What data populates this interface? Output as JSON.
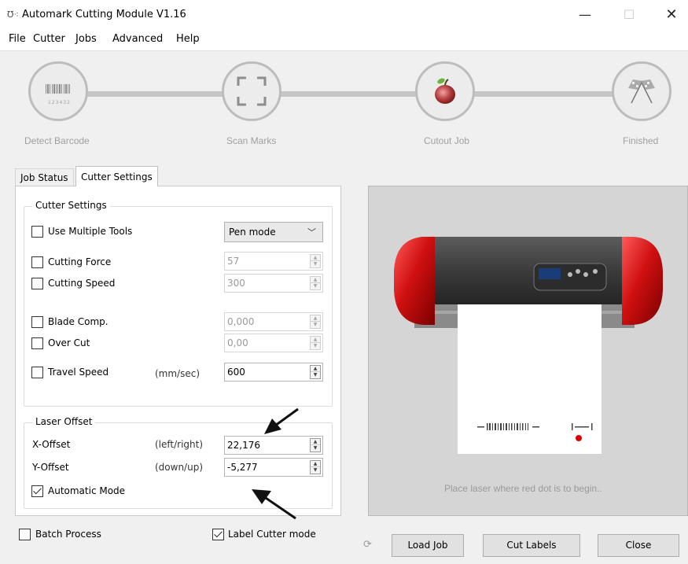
{
  "window": {
    "title": "Automark Cutting Module V1.16",
    "controls": {
      "minimize": "—",
      "maximize": "☐",
      "close": "✕"
    }
  },
  "menu": [
    "File",
    "Cutter",
    "Jobs",
    "Advanced",
    "Help"
  ],
  "steps": [
    {
      "label": "Detect Barcode",
      "icon": "barcode-icon",
      "barcode_digits": "123432"
    },
    {
      "label": "Scan Marks",
      "icon": "scan-frame-icon"
    },
    {
      "label": "Cutout Job",
      "icon": "apple-icon"
    },
    {
      "label": "Finished",
      "icon": "checkered-flags-icon"
    }
  ],
  "tabs": {
    "job_status": "Job Status",
    "cutter_settings": "Cutter Settings",
    "selected": "Cutter Settings"
  },
  "cutter_settings": {
    "group_title": "Cutter Settings",
    "use_multiple_tools": {
      "label": "Use Multiple Tools",
      "checked": false
    },
    "tool_mode": {
      "value": "Pen mode"
    },
    "cutting_force": {
      "label": "Cutting Force",
      "checked": false,
      "value": "57"
    },
    "cutting_speed": {
      "label": "Cutting Speed",
      "checked": false,
      "value": "300"
    },
    "blade_comp": {
      "label": "Blade Comp.",
      "checked": false,
      "value": "0,000"
    },
    "over_cut": {
      "label": "Over Cut",
      "checked": false,
      "value": "0,00"
    },
    "travel_speed": {
      "label": "Travel Speed",
      "checked": false,
      "unit": "(mm/sec)",
      "value": "600"
    }
  },
  "laser_offset": {
    "group_title": "Laser Offset",
    "x_offset": {
      "label": "X-Offset",
      "unit": "(left/right)",
      "value": "22,176"
    },
    "y_offset": {
      "label": "Y-Offset",
      "unit": "(down/up)",
      "value": "-5,277"
    },
    "automatic_mode": {
      "label": "Automatic Mode",
      "checked": true
    }
  },
  "bottom": {
    "batch_process": {
      "label": "Batch Process",
      "checked": false
    },
    "label_cutter_mode": {
      "label": "Label Cutter mode",
      "checked": true
    },
    "load_job": "Load Job",
    "cut_labels": "Cut Labels",
    "close": "Close"
  },
  "preview": {
    "caption": "Place laser where red dot is to begin..",
    "cutter_color": "#cc1111",
    "dot_color": "#e00000"
  },
  "colors": {
    "window_bg": "#f0f0f0",
    "step_label": "#a0a0a0",
    "preview_bg": "#d5d5d5"
  }
}
